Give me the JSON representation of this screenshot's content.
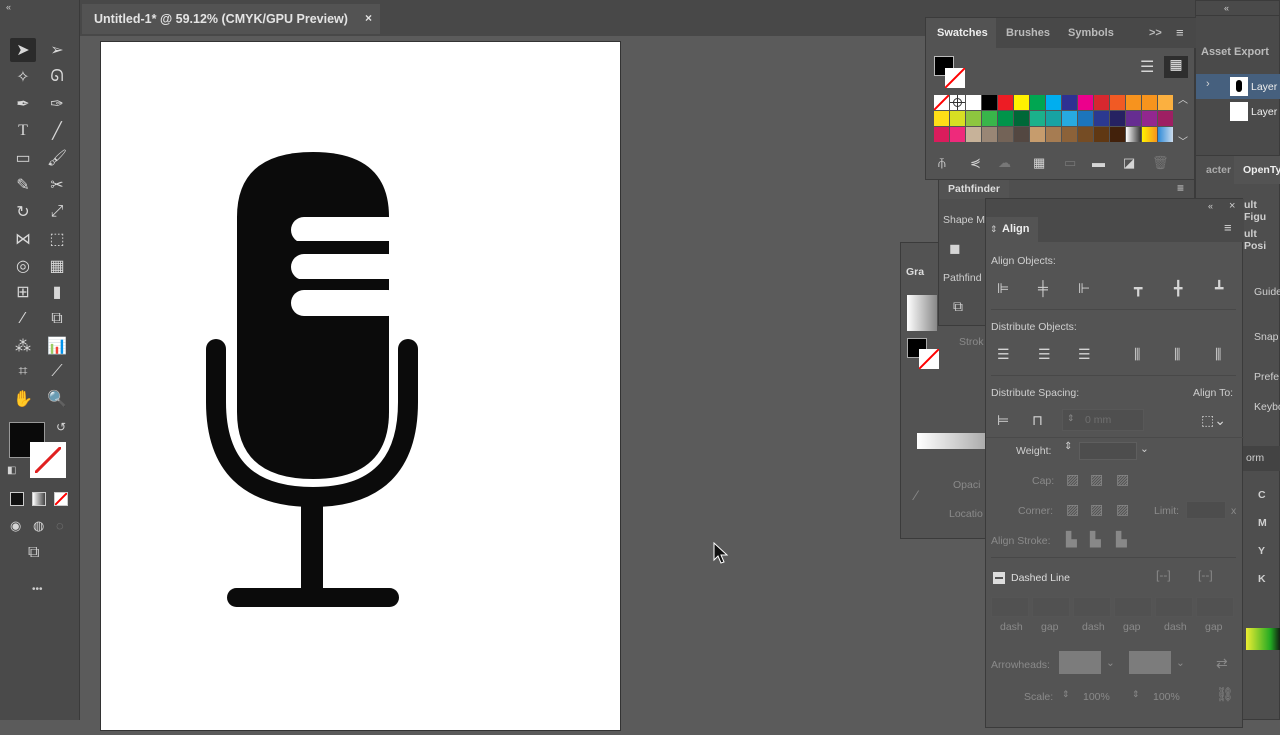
{
  "document_tab": {
    "title": "Untitled-1* @ 59.12% (CMYK/GPU Preview)",
    "close": "×"
  },
  "toolbar": {
    "collapse": "«",
    "more": "•••"
  },
  "swatches_panel": {
    "tabs": [
      "Swatches",
      "Brushes",
      "Symbols"
    ],
    "more_tabs": ">>",
    "colors": [
      [
        "none",
        "registration",
        "#ffffff",
        "#000000",
        "#ed1c24",
        "#fff200",
        "#00a651",
        "#00aeef",
        "#2e3192",
        "#ec008c",
        "#d7282f",
        "#f15a24",
        "#f7931e",
        "#f7941d",
        "#fbb040"
      ],
      [
        "#ffde17",
        "#d7df23",
        "#8dc63f",
        "#39b54a",
        "#00944a",
        "#006838",
        "#1bb18b",
        "#17a3a3",
        "#27aae1",
        "#1c75bc",
        "#2b3990",
        "#262262",
        "#662d91",
        "#92278f",
        "#9e1f63"
      ],
      [
        "#da1c5c",
        "#ee2a7b",
        "#c7b299",
        "#998675",
        "#736357",
        "#534741",
        "#c69c6d",
        "#a67c52",
        "#8c6239",
        "#754c24",
        "#603813",
        "#42210b",
        "gradient-gray",
        "gradient-orange",
        "gradient-blue"
      ]
    ]
  },
  "layers_panel": {
    "tab": "Asset Export",
    "layers": [
      "Layer",
      "Layer"
    ],
    "collapse": "«"
  },
  "pathfinder_panel": {
    "title": "Pathfinder",
    "shape_modes": "Shape M",
    "pathfinders": "Pathfind"
  },
  "gradient_panel": {
    "title": "Gra",
    "stroke": "Strok",
    "opacity": "Opaci",
    "location": "Locatio"
  },
  "align_panel": {
    "title": "Align",
    "align_objects": "Align Objects:",
    "distribute_objects": "Distribute Objects:",
    "distribute_spacing": "Distribute Spacing:",
    "align_to": "Align To:",
    "spacing_value": "0 mm"
  },
  "stroke_panel": {
    "weight": "Weight:",
    "cap": "Cap:",
    "corner": "Corner:",
    "limit": "Limit:",
    "limit_unit": "x",
    "align_stroke": "Align Stroke:",
    "dashed_line": "Dashed Line",
    "dash_labels": [
      "dash",
      "gap",
      "dash",
      "gap",
      "dash",
      "gap"
    ],
    "arrowheads": "Arrowheads:",
    "scale": "Scale:",
    "scale_values": [
      "100%",
      "100%"
    ]
  },
  "right_panel": {
    "tabs": [
      "acter",
      "OpenTy"
    ],
    "items": [
      "ult Figu",
      "ult Posi",
      "Guide",
      "Snap",
      "Prefe",
      "Keybo"
    ],
    "transform_tab": "orm",
    "cmyk": [
      "C",
      "M",
      "Y",
      "K"
    ]
  }
}
